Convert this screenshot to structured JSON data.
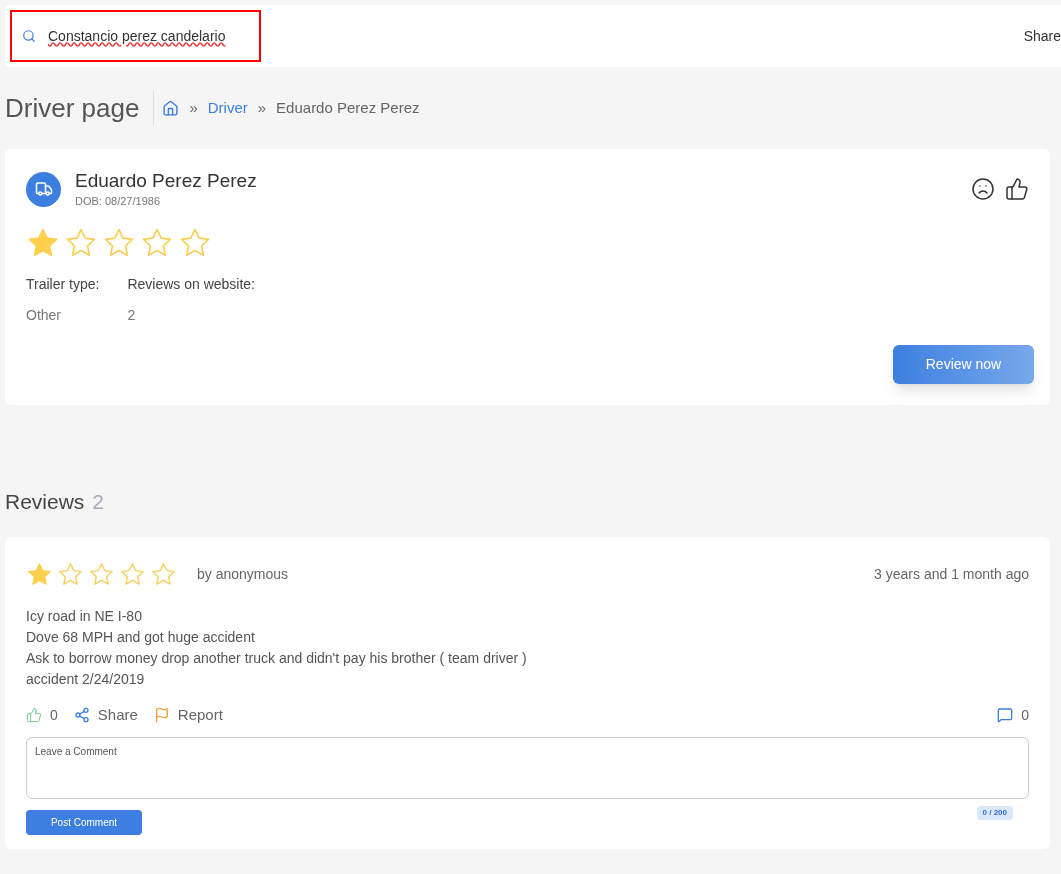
{
  "search": {
    "value": "Constancio perez candelario"
  },
  "top_bar": {
    "share": "Share"
  },
  "page": {
    "title": "Driver page",
    "breadcrumb": [
      {
        "label": "Driver",
        "link": true
      },
      {
        "label": "Eduardo Perez Perez",
        "link": false
      }
    ],
    "separator": "»"
  },
  "driver": {
    "name": "Eduardo Perez Perez",
    "dob": "DOB: 08/27/1986",
    "stars": 1,
    "fields": [
      {
        "label": "Trailer type:",
        "value": "Other"
      },
      {
        "label": "Reviews on website:",
        "value": "2"
      }
    ],
    "button": "Review now"
  },
  "reviews": {
    "title": "Reviews",
    "count": "2",
    "items": [
      {
        "stars": 1,
        "author": "by anonymous",
        "time": "3 years and 1 month ago",
        "lines": [
          "Icy road in NE I-80",
          "Dove 68 MPH and got huge accident",
          "Ask to borrow money drop another truck and didn't pay his brother ( team driver )",
          "accident 2/24/2019"
        ],
        "likes": "0",
        "share": "Share",
        "report": "Report",
        "comments": "0",
        "comment_placeholder": "Leave a Comment",
        "counter": "0 / 200",
        "post": "Post Comment"
      }
    ]
  }
}
